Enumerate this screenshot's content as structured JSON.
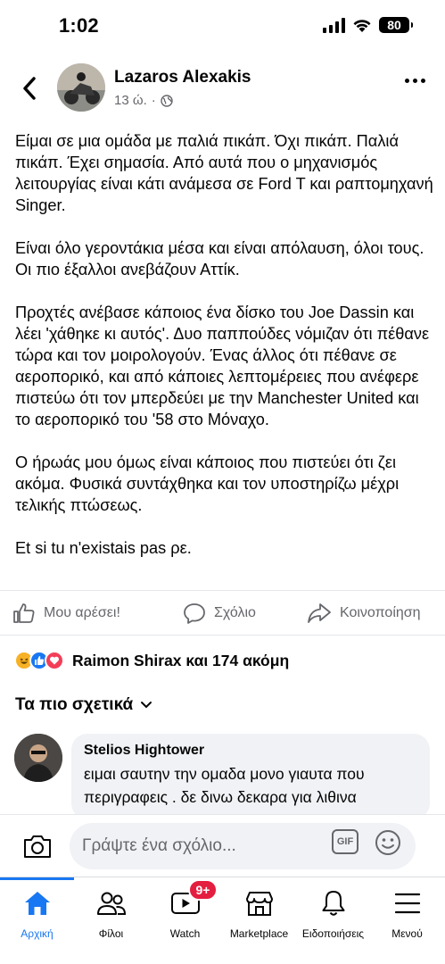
{
  "status_bar": {
    "time": "1:02",
    "battery": "80"
  },
  "post": {
    "author": "Lazaros Alexakis",
    "time": "13 ώ.",
    "separator": "·",
    "paragraphs": [
      "Είμαι σε μια ομάδα με παλιά πικάπ. Όχι πικάπ. Παλιά πικάπ. Έχει σημασία. Από αυτά που ο μηχανισμός λειτουργίας είναι κάτι ανάμεσα σε Ford T και ραπτομηχανή Singer.",
      "Είναι όλο γεροντάκια μέσα και είναι απόλαυση, όλοι τους. Οι πιο έξαλλοι ανεβάζουν Αττίκ.",
      "Προχτές ανέβασε κάποιος ένα δίσκο του Joe Dassin και λέει 'χάθηκε κι αυτός'. Δυο παππούδες νόμιζαν ότι πέθανε τώρα και τον μοιρολογούν. Ένας άλλος ότι πέθανε σε αεροπορικό, και από κάποιες λεπτομέρειες που ανέφερε πιστεύω ότι τον μπερδεύει με την Manchester United και το αεροπορικό του '58 στο Μόναχο.",
      "Ο ήρωάς μου όμως είναι κάποιος που πιστεύει ότι ζει ακόμα. Φυσικά συντάχθηκα και τον υποστηρίζω μέχρι τελικής πτώσεως.",
      "Et si tu n'existais pas ρε."
    ]
  },
  "actions": {
    "like": "Μου αρέσει!",
    "comment": "Σχόλιο",
    "share": "Κοινοποίηση"
  },
  "reactions": {
    "summary": "Raimon Shirax και 174 ακόμη"
  },
  "sort": {
    "label": "Τα πιο σχετικά"
  },
  "comment": {
    "author": "Stelios Hightower",
    "text": "ειμαι σαυτην την ομαδα μονο γιαυτα που περιγραφεις . δε δινω δεκαρα για λιθινα"
  },
  "composer": {
    "placeholder": "Γράψτε ένα σχόλιο...",
    "gif": "GIF"
  },
  "tabs": [
    {
      "label": "Αρχική",
      "icon": "home-icon"
    },
    {
      "label": "Φίλοι",
      "icon": "friends-icon"
    },
    {
      "label": "Watch",
      "icon": "watch-icon",
      "badge": "9+"
    },
    {
      "label": "Marketplace",
      "icon": "marketplace-icon"
    },
    {
      "label": "Ειδοποιήσεις",
      "icon": "bell-icon"
    },
    {
      "label": "Μενού",
      "icon": "menu-icon"
    }
  ],
  "colors": {
    "accent": "#1877f2",
    "badge": "#e41e3f",
    "secondary_text": "#65676b"
  }
}
